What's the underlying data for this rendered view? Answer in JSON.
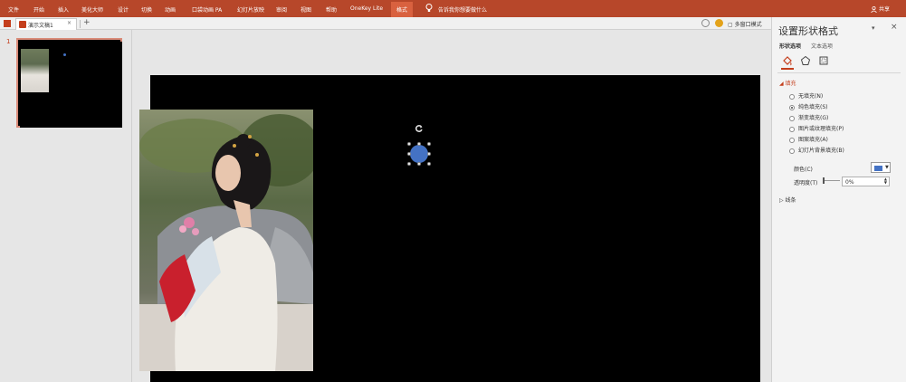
{
  "ribbon": {
    "tabs": [
      "文件",
      "开始",
      "插入",
      "美化大师",
      "设计",
      "切换",
      "动画",
      "口袋动画 PA",
      "幻灯片放映",
      "审阅",
      "视图",
      "帮助",
      "OneKey Lite",
      "格式"
    ],
    "active_tab": "格式",
    "tell_me": "告诉我你想要做什么",
    "share": "共享"
  },
  "docbar": {
    "doc_name": "演示文稿1",
    "close": "×",
    "new_tab": "+",
    "multi_window": "多窗口模式"
  },
  "thumbnails": {
    "slide_number": "1"
  },
  "pane": {
    "title": "设置形状格式",
    "tab_shape": "形状选项",
    "tab_text": "文本选项",
    "section_fill": "填充",
    "fill_options": [
      {
        "label": "无填充(N)",
        "selected": false
      },
      {
        "label": "纯色填充(S)",
        "selected": true
      },
      {
        "label": "渐变填充(G)",
        "selected": false
      },
      {
        "label": "图片或纹理填充(P)",
        "selected": false
      },
      {
        "label": "图案填充(A)",
        "selected": false
      },
      {
        "label": "幻灯片背景填充(B)",
        "selected": false
      }
    ],
    "color_label": "颜色(C)",
    "transparency_label": "透明度(T)",
    "transparency_value": "0%",
    "section_line": "线条"
  },
  "colors": {
    "accent": "#b7472a",
    "shape_fill": "#4472c4"
  }
}
